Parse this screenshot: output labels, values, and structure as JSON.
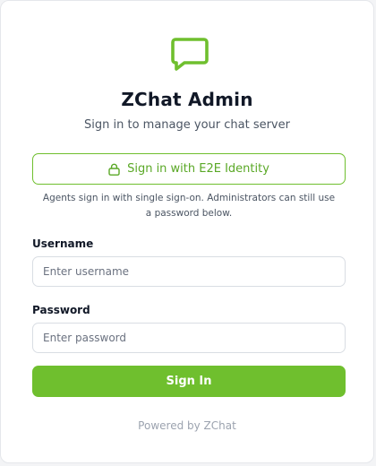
{
  "app": {
    "title": "ZChat Admin",
    "subtitle": "Sign in to manage your chat server",
    "logo_icon": "chat-bubble-icon"
  },
  "sso": {
    "button_label": "Sign in with E2E Identity",
    "icon": "lock-icon",
    "hint": "Agents sign in with single sign-on. Administrators can still use a password below."
  },
  "form": {
    "username_label": "Username",
    "username_placeholder": "Enter username",
    "username_value": "",
    "password_label": "Password",
    "password_placeholder": "Enter password",
    "password_value": "",
    "submit_label": "Sign In"
  },
  "footer": {
    "text": "Powered by ZChat"
  },
  "colors": {
    "accent": "#6fbf2e",
    "accent_text": "#5aa826",
    "title": "#111827",
    "muted": "#9ca3af"
  }
}
